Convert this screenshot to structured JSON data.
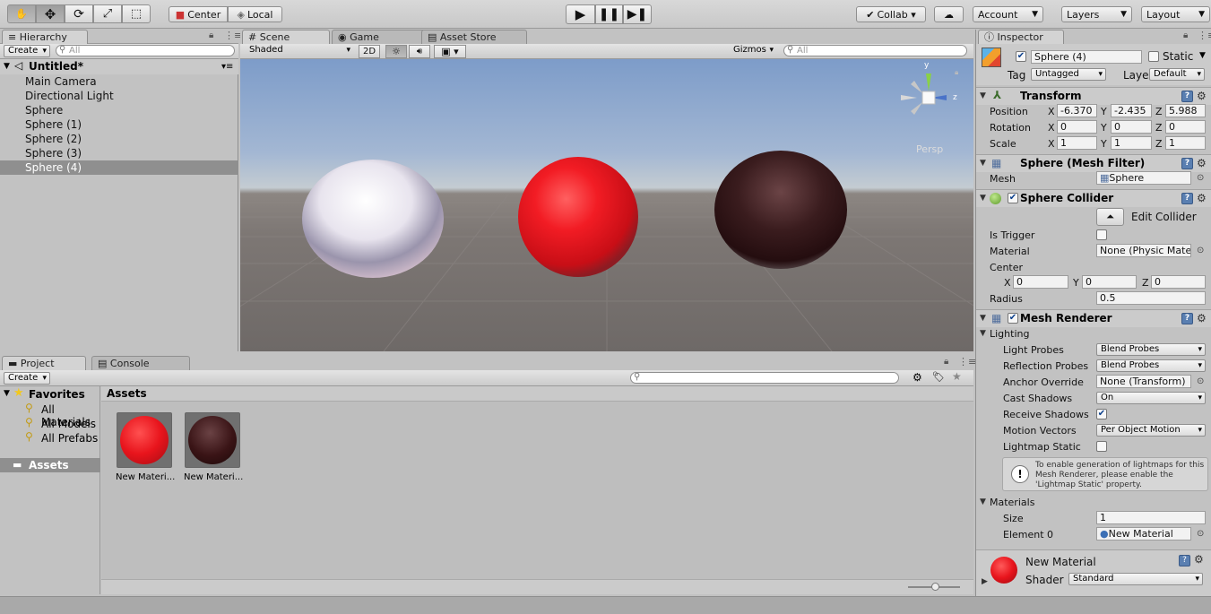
{
  "toolbar": {
    "center_label": "Center",
    "local_label": "Local",
    "collab_label": "Collab ▾",
    "account_label": "Account",
    "layers_label": "Layers",
    "layout_label": "Layout"
  },
  "hierarchy": {
    "tab": "Hierarchy",
    "create": "Create",
    "search_placeholder": "All",
    "scene": "Untitled*",
    "items": [
      "Main Camera",
      "Directional Light",
      "Sphere",
      "Sphere (1)",
      "Sphere (2)",
      "Sphere (3)",
      "Sphere (4)"
    ]
  },
  "scene": {
    "tabs": [
      "Scene",
      "Game",
      "Asset Store"
    ],
    "shading": "Shaded",
    "mode2d": "2D",
    "gizmos": "Gizmos",
    "search_placeholder": "All",
    "persp": "Persp",
    "axis_y": "y",
    "axis_z": "z"
  },
  "project": {
    "tabs": [
      "Project",
      "Console"
    ],
    "create": "Create",
    "favorites": "Favorites",
    "fav_items": [
      "All Materials",
      "All Models",
      "All Prefabs"
    ],
    "assets_folder": "Assets",
    "assets_header": "Assets",
    "asset_items": [
      "New Materi...",
      "New Materi..."
    ]
  },
  "inspector": {
    "tab": "Inspector",
    "object_name": "Sphere (4)",
    "static": "Static",
    "tag_label": "Tag",
    "tag": "Untagged",
    "layer_label": "Layer",
    "layer": "Default",
    "transform": {
      "title": "Transform",
      "position_label": "Position",
      "rotation_label": "Rotation",
      "scale_label": "Scale",
      "pos": [
        "-6.370",
        "-2.435",
        "5.988"
      ],
      "rot": [
        "0",
        "0",
        "0"
      ],
      "scale": [
        "1",
        "1",
        "1"
      ],
      "x": "X",
      "y": "Y",
      "z": "Z"
    },
    "mesh_filter": {
      "title": "Sphere (Mesh Filter)",
      "mesh_label": "Mesh",
      "mesh": "Sphere"
    },
    "collider": {
      "title": "Sphere Collider",
      "edit": "Edit Collider",
      "trigger_label": "Is Trigger",
      "material_label": "Material",
      "material": "None (Physic Mate",
      "center_label": "Center",
      "center": [
        "0",
        "0",
        "0"
      ],
      "radius_label": "Radius",
      "radius": "0.5"
    },
    "renderer": {
      "title": "Mesh Renderer",
      "lighting": "Lighting",
      "light_probes_label": "Light Probes",
      "light_probes": "Blend Probes",
      "refl_label": "Reflection Probes",
      "refl": "Blend Probes",
      "anchor_label": "Anchor Override",
      "anchor": "None (Transform)",
      "cast_label": "Cast Shadows",
      "cast": "On",
      "receive_label": "Receive Shadows",
      "motion_label": "Motion Vectors",
      "motion": "Per Object Motion",
      "lightmap_label": "Lightmap Static",
      "help": "To enable generation of lightmaps for this Mesh Renderer, please enable the 'Lightmap Static' property.",
      "materials_label": "Materials",
      "size_label": "Size",
      "size": "1",
      "element_label": "Element 0",
      "element": "New Material"
    },
    "material": {
      "name": "New Material",
      "shader_label": "Shader",
      "shader": "Standard"
    }
  },
  "colors": {
    "red_sphere": "#e8141c",
    "dark_sphere": "#3a1414",
    "selection": "#8f8f8f"
  }
}
